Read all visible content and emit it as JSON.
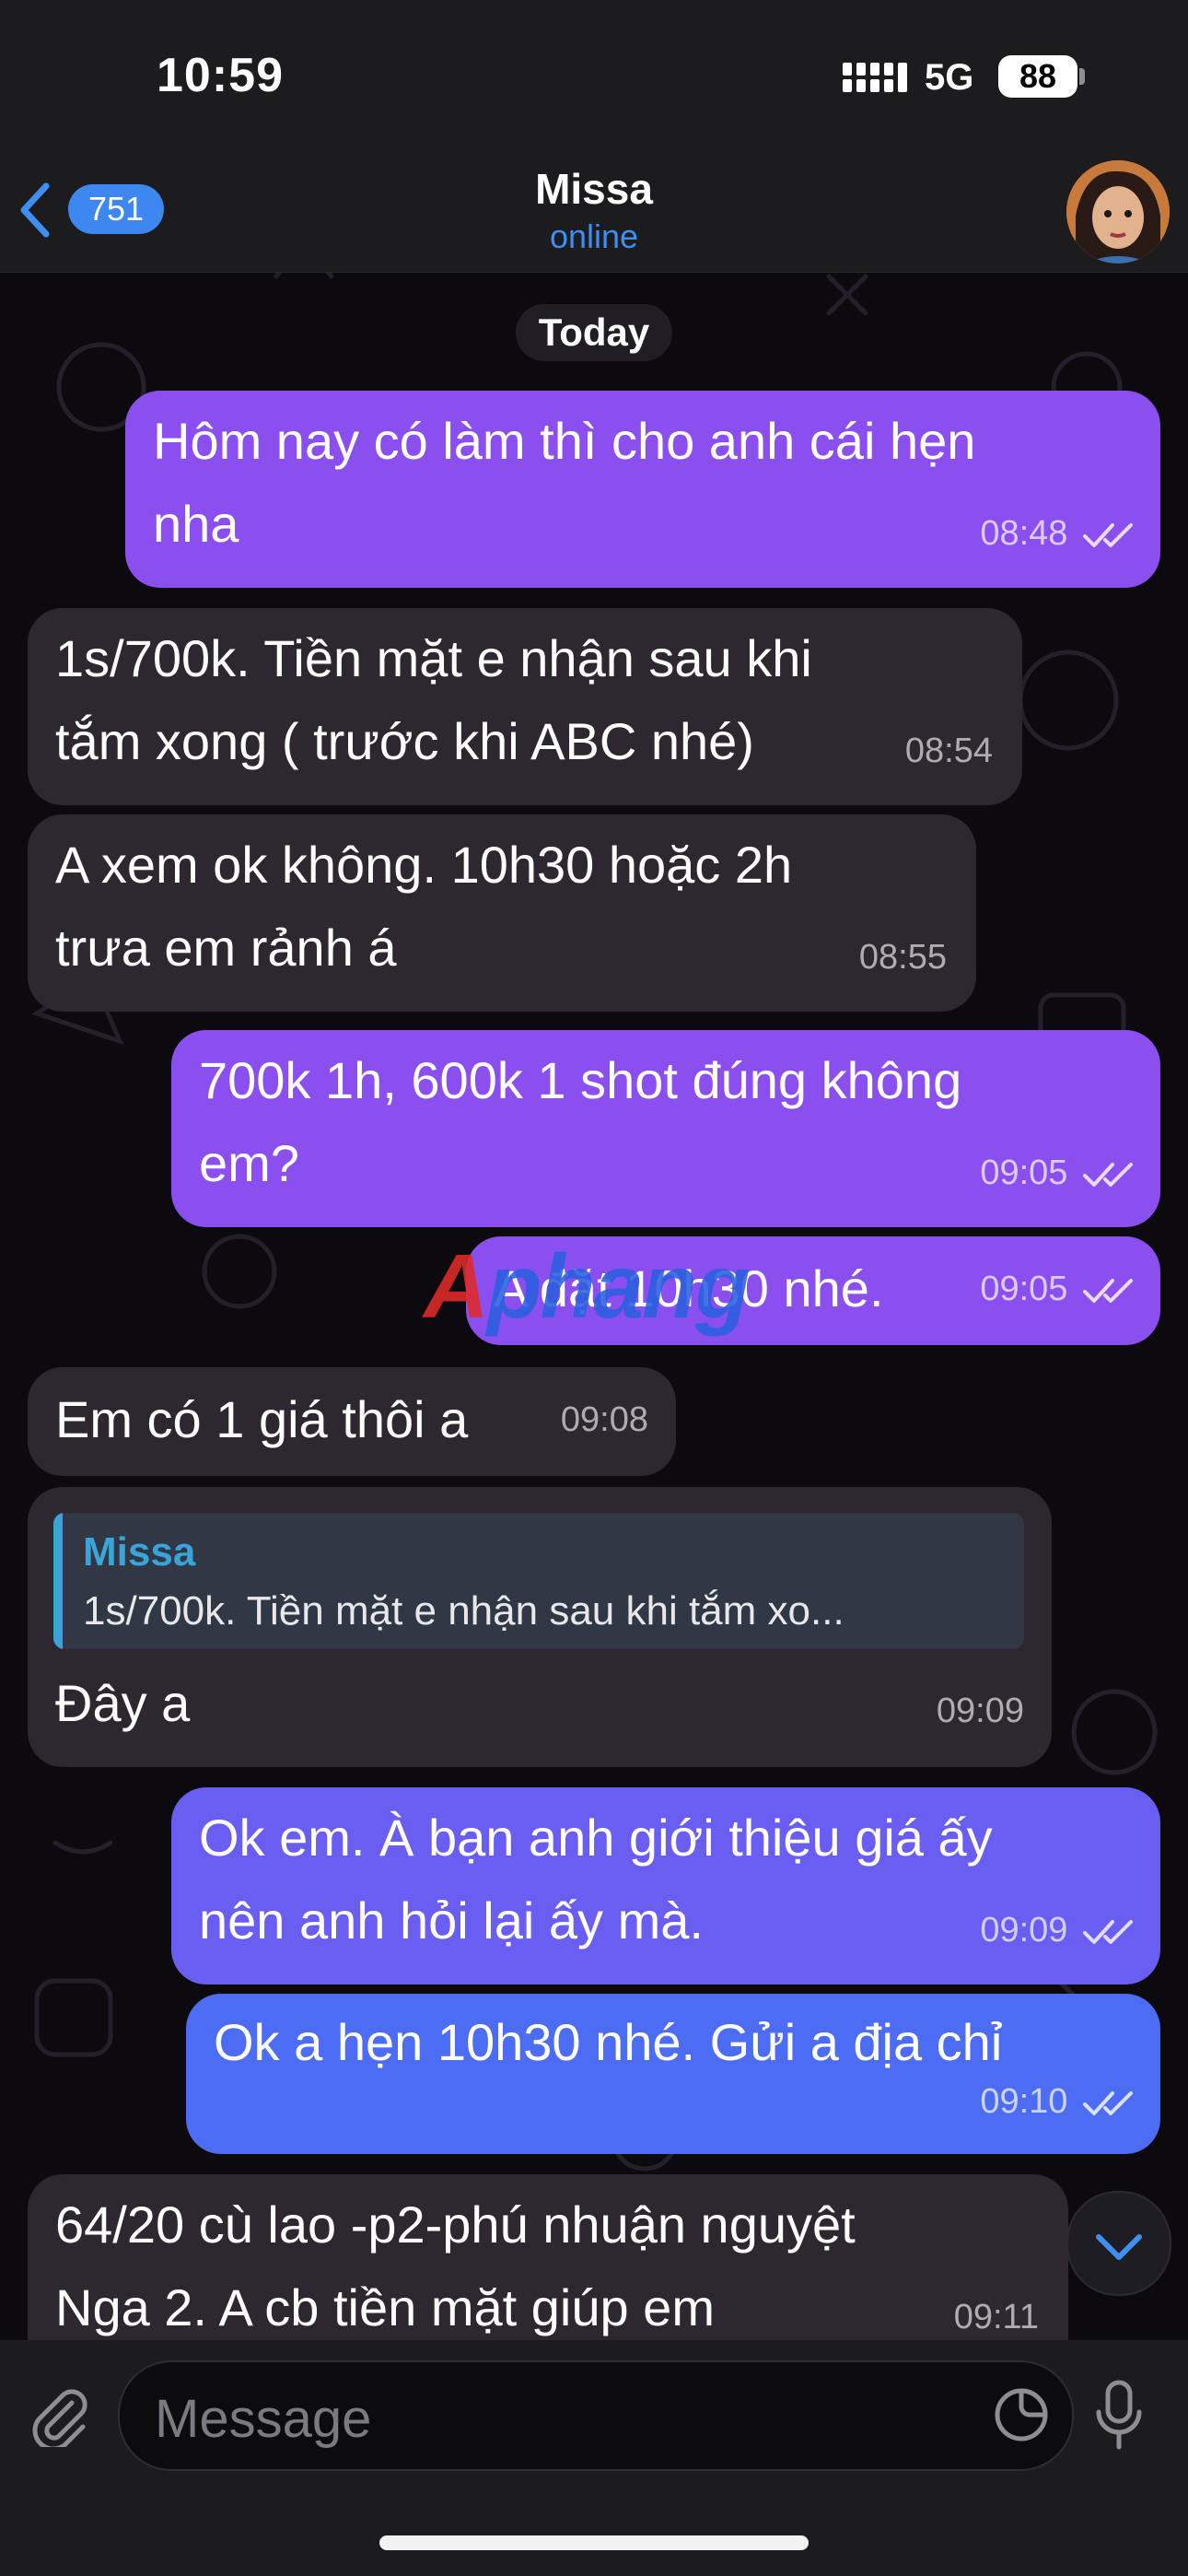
{
  "status_bar": {
    "time": "10:59",
    "network": "5G",
    "battery": "88"
  },
  "header": {
    "back_count": "751",
    "name": "Missa",
    "status": "online"
  },
  "date_label": "Today",
  "messages": [
    {
      "lines": [
        "Hôm nay có làm thì cho anh cái hẹn",
        "nha"
      ],
      "time": "08:48"
    },
    {
      "lines": [
        "1s/700k. Tiền mặt  e nhận sau  khi",
        "tắm xong ( trước khi ABC nhé)"
      ],
      "time": "08:54"
    },
    {
      "lines": [
        "A xem ok không. 10h30 hoặc 2h",
        "trưa em rảnh á"
      ],
      "time": "08:55"
    },
    {
      "lines": [
        "700k 1h, 600k 1 shot đúng không",
        "em?"
      ],
      "time": "09:05"
    },
    {
      "lines": [
        "A đặt 10h30 nhé."
      ],
      "time": "09:05"
    },
    {
      "lines": [
        "Em có 1 giá thôi a"
      ],
      "time": "09:08"
    },
    {
      "reply": {
        "name": "Missa",
        "text": "1s/700k. Tiền mặt e nhận sau khi tắm xo..."
      },
      "lines": [
        "Đây a"
      ],
      "time": "09:09"
    },
    {
      "lines": [
        "Ok em. À bạn anh giới thiệu giá ấy",
        "nên anh hỏi lại ấy mà."
      ],
      "time": "09:09"
    },
    {
      "lines": [
        "Ok a hẹn 10h30 nhé. Gửi a địa chỉ"
      ],
      "time": "09:10"
    },
    {
      "lines": [
        "64/20 cù lao -p2-phú nhuận nguyệt",
        "Nga 2. A cb tiền mặt giúp em"
      ],
      "time": "09:11"
    }
  ],
  "watermark": {
    "part1": "A",
    "part2": "phang"
  },
  "composer": {
    "placeholder": "Message"
  },
  "icons": [
    "back-chevron-icon",
    "signal-icon",
    "attach-icon",
    "sticker-icon",
    "microphone-icon",
    "chevron-down-icon",
    "double-check-icon"
  ],
  "colors": {
    "outgoing": "#8b4ff0",
    "outgoing_bottom": "#4d6cf4",
    "incoming": "#2d2730",
    "accent": "#3f8ef2",
    "reply_accent": "#3aa3d8"
  }
}
